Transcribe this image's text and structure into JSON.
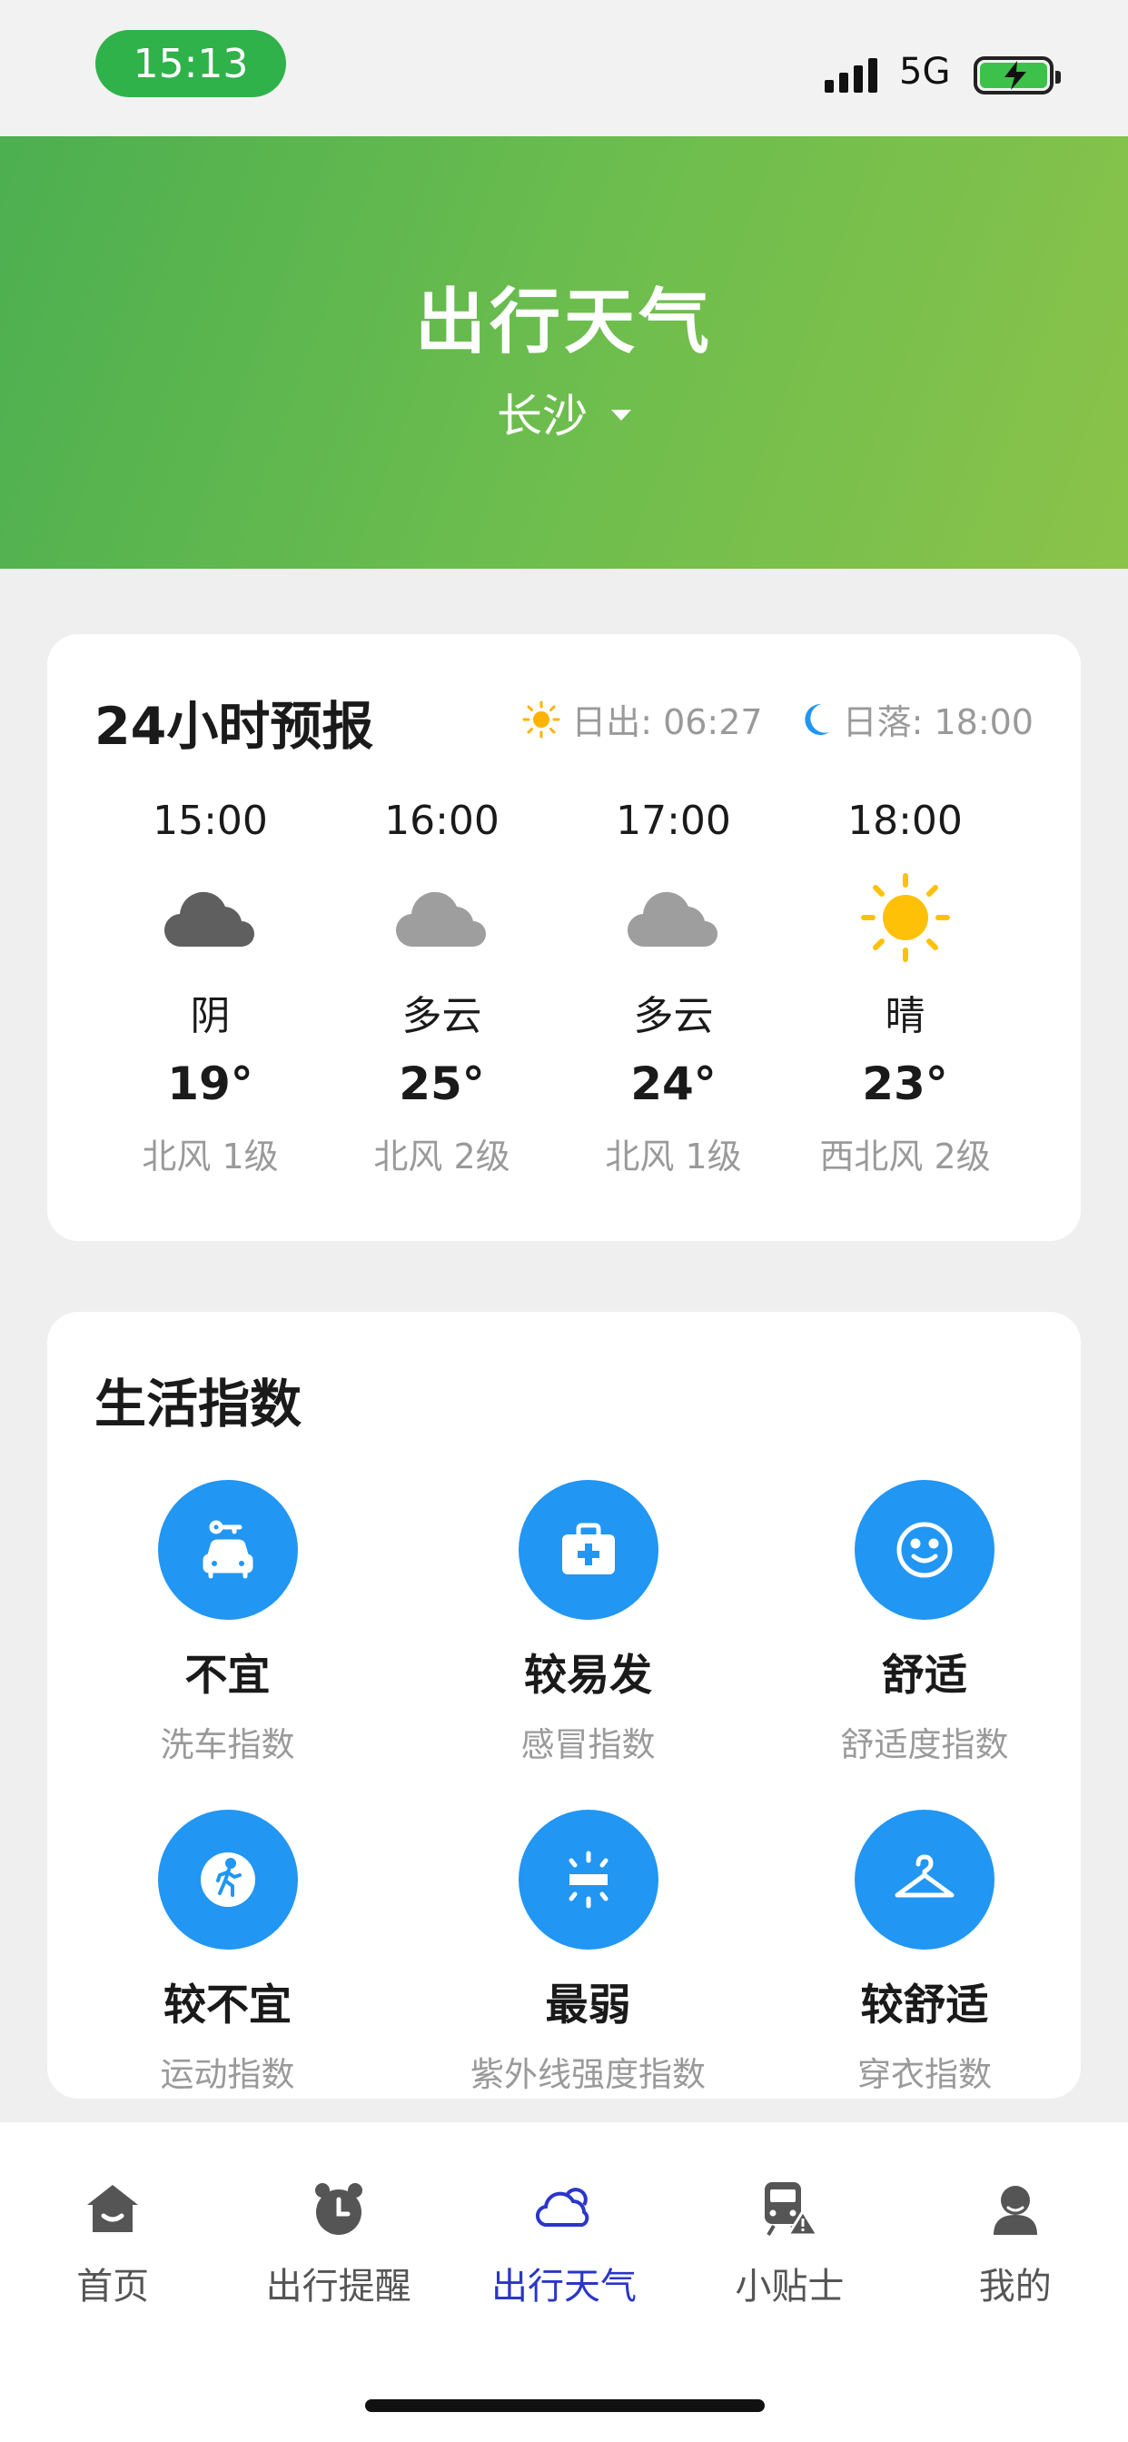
{
  "status_bar": {
    "time": "15:13",
    "network": "5G",
    "time_pill_color": "#2fb24a"
  },
  "header": {
    "title": "出行天气",
    "city": "长沙",
    "gradient": [
      "#4caf50",
      "#8bc34a"
    ]
  },
  "forecast": {
    "title": "24小时预报",
    "sunrise": "日出: 06:27",
    "sunset": "日落: 18:00",
    "hours": [
      {
        "time": "15:00",
        "icon": "cloud-dark-icon",
        "condition": "阴",
        "temp": "19°",
        "wind": "北风 1级"
      },
      {
        "time": "16:00",
        "icon": "cloud-icon",
        "condition": "多云",
        "temp": "25°",
        "wind": "北风 2级"
      },
      {
        "time": "17:00",
        "icon": "cloud-icon",
        "condition": "多云",
        "temp": "24°",
        "wind": "北风 1级"
      },
      {
        "time": "18:00",
        "icon": "sun-icon",
        "condition": "晴",
        "temp": "23°",
        "wind": "西北风 2级"
      }
    ]
  },
  "life_index": {
    "title": "生活指数",
    "accent": "#2196f3",
    "items": [
      {
        "icon": "car-wash-icon",
        "value": "不宜",
        "label": "洗车指数"
      },
      {
        "icon": "medical-kit-icon",
        "value": "较易发",
        "label": "感冒指数"
      },
      {
        "icon": "smile-icon",
        "value": "舒适",
        "label": "舒适度指数"
      },
      {
        "icon": "running-icon",
        "value": "较不宜",
        "label": "运动指数"
      },
      {
        "icon": "uv-icon",
        "value": "最弱",
        "label": "紫外线强度指数"
      },
      {
        "icon": "hanger-icon",
        "value": "较舒适",
        "label": "穿衣指数"
      }
    ]
  },
  "bottom_nav": {
    "active_color": "#2a36c9",
    "tabs": [
      {
        "label": "首页",
        "icon": "home-icon"
      },
      {
        "label": "出行提醒",
        "icon": "alarm-clock-icon"
      },
      {
        "label": "出行天气",
        "icon": "weather-cloud-icon",
        "active": true
      },
      {
        "label": "小贴士",
        "icon": "train-warning-icon"
      },
      {
        "label": "我的",
        "icon": "user-icon"
      }
    ]
  }
}
